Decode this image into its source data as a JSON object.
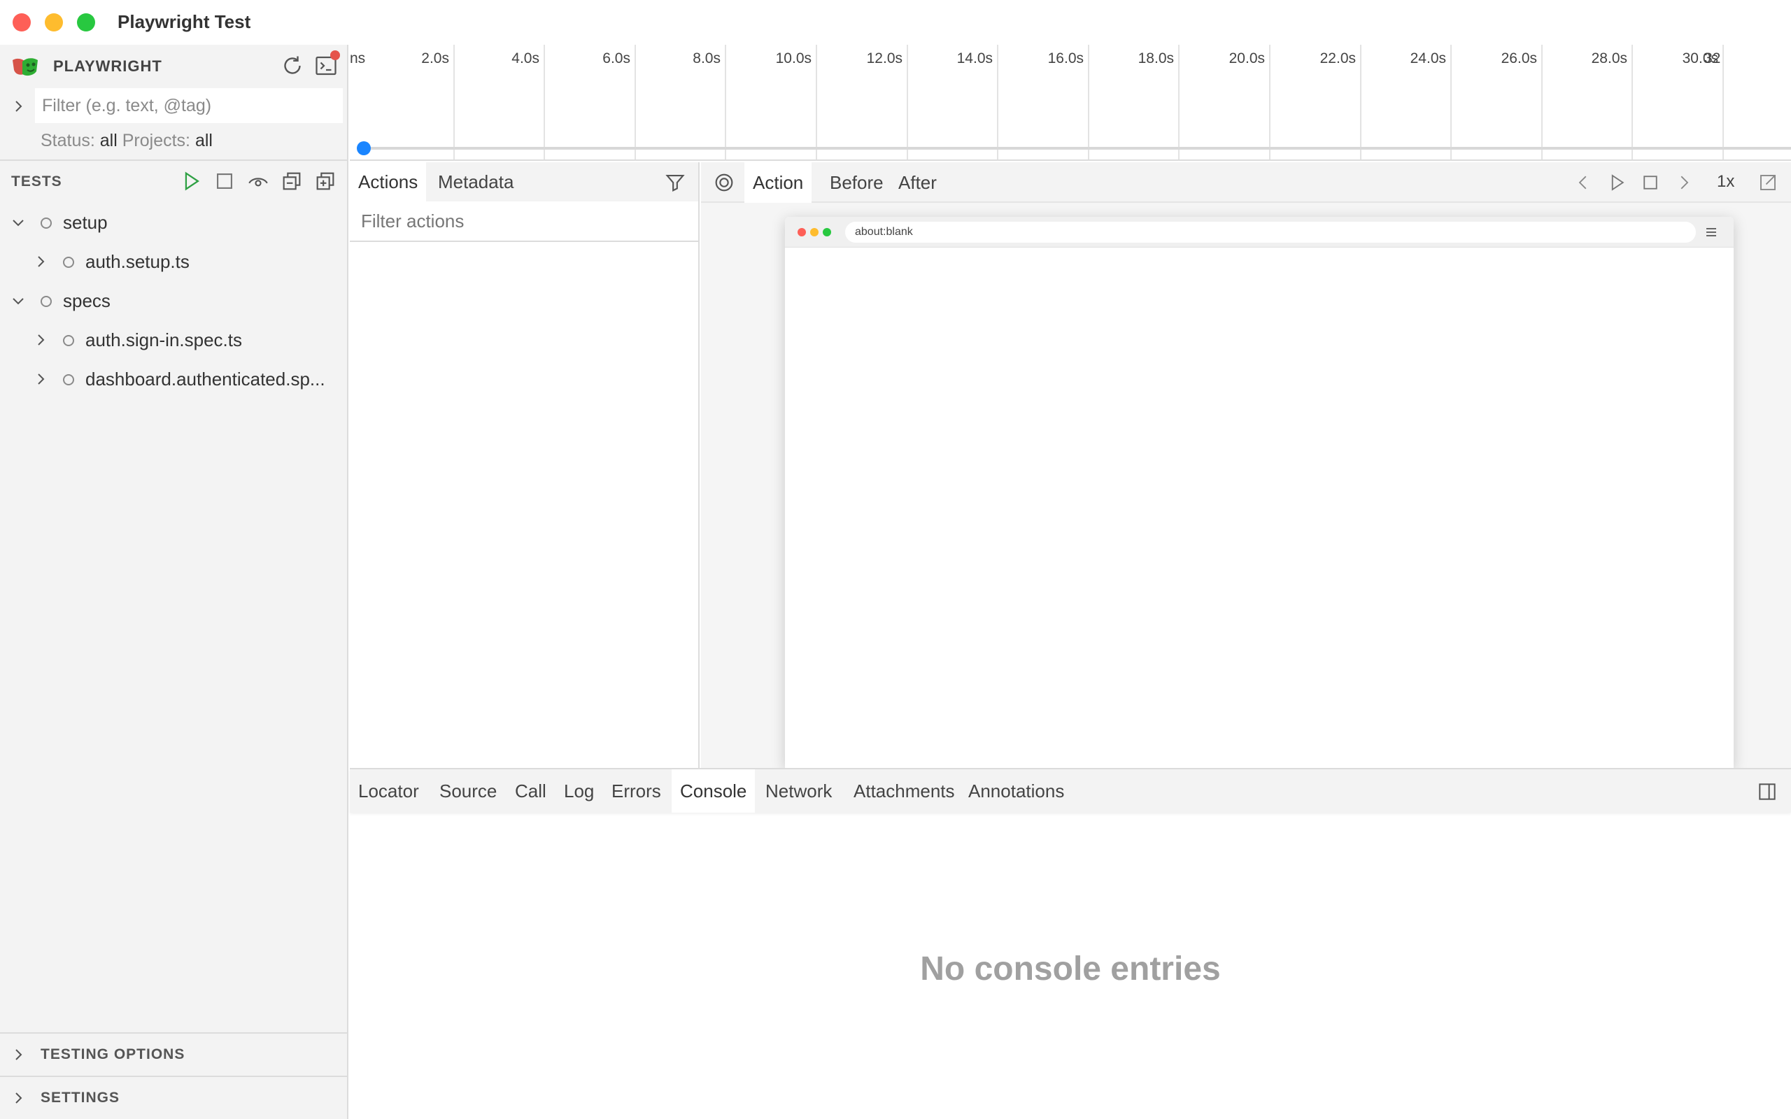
{
  "window": {
    "title": "Playwright Test"
  },
  "sidebar": {
    "brand": "PLAYWRIGHT",
    "filter": {
      "placeholder": "Filter (e.g. text, @tag)",
      "value": ""
    },
    "status": {
      "status_label": "Status:",
      "status_value": "all",
      "projects_label": "Projects:",
      "projects_value": "all"
    },
    "tests_header": "TESTS",
    "tree": [
      {
        "label": "setup",
        "expanded": true
      },
      {
        "label": "auth.setup.ts",
        "expanded": false
      },
      {
        "label": "specs",
        "expanded": true
      },
      {
        "label": "auth.sign-in.spec.ts",
        "expanded": false
      },
      {
        "label": "dashboard.authenticated.sp...",
        "expanded": false
      }
    ],
    "sections": [
      "TESTING OPTIONS",
      "SETTINGS"
    ]
  },
  "timeline": {
    "ticks": [
      "ns",
      "2.0s",
      "4.0s",
      "6.0s",
      "8.0s",
      "10.0s",
      "12.0s",
      "14.0s",
      "16.0s",
      "18.0s",
      "20.0s",
      "22.0s",
      "24.0s",
      "26.0s",
      "28.0s",
      "30.0s",
      "32"
    ],
    "accent": "#1a85ff"
  },
  "actions_panel": {
    "tabs": [
      "Actions",
      "Metadata"
    ],
    "selected_tab": "Actions",
    "filter_placeholder": "Filter actions"
  },
  "snapshot_panel": {
    "tabs": [
      "Action",
      "Before",
      "After"
    ],
    "selected_tab": "Action",
    "speed": "1x",
    "url": "about:blank"
  },
  "details_panel": {
    "tabs": [
      "Locator",
      "Source",
      "Call",
      "Log",
      "Errors",
      "Console",
      "Network",
      "Attachments",
      "Annotations"
    ],
    "selected_tab": "Console",
    "empty_message": "No console entries"
  },
  "colors": {
    "run_green": "#2ea043",
    "notification_red": "#e5534b",
    "traffic_close": "#fe5f57",
    "traffic_min": "#febc2e",
    "traffic_max": "#28c840"
  }
}
